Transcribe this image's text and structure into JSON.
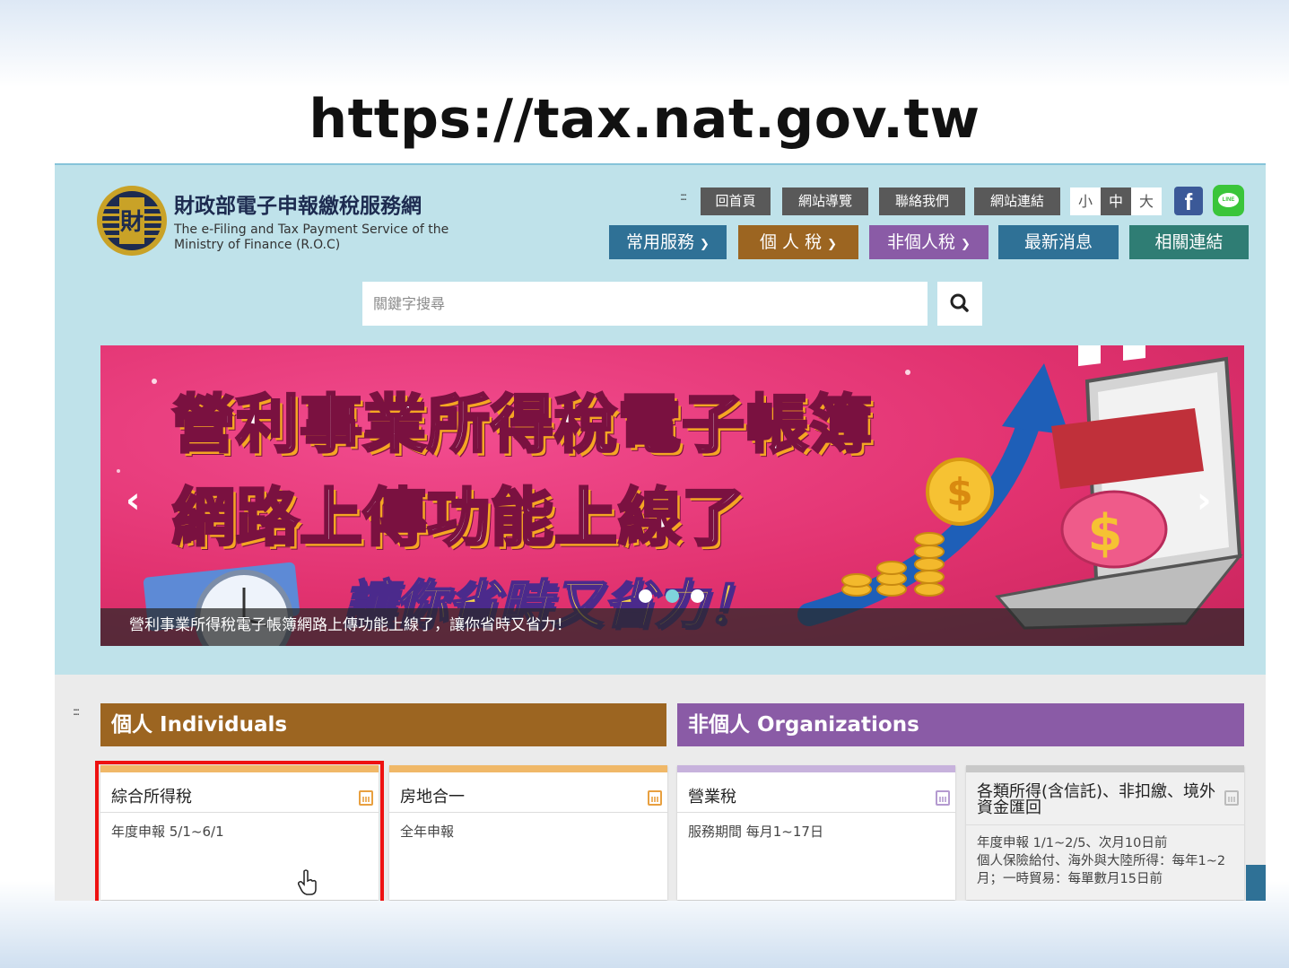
{
  "slide": {
    "title": "https://tax.nat.gov.tw"
  },
  "header": {
    "site_name": "財政部電子申報繳稅服務網",
    "site_sub": "The e-Filing and Tax Payment Service of the Ministry of Finance (R.O.C)",
    "grip": ":::",
    "top_links": [
      "回首頁",
      "網站導覽",
      "聯絡我們",
      "網站連結"
    ],
    "font_sizes": [
      "小",
      "中",
      "大"
    ],
    "social": {
      "facebook": "f",
      "line": "LINE"
    }
  },
  "nav": [
    {
      "label": "常用服務",
      "color": "#2f7196",
      "has_dropdown": true
    },
    {
      "label": "個 人 稅",
      "color": "#9c6521",
      "has_dropdown": true
    },
    {
      "label": "非個人稅",
      "color": "#8a5ba6",
      "has_dropdown": true
    },
    {
      "label": "最新消息",
      "color": "#2f7196",
      "has_dropdown": false
    },
    {
      "label": "相關連結",
      "color": "#2f7d74",
      "has_dropdown": false
    }
  ],
  "search": {
    "placeholder": "關鍵字搜尋",
    "icon": "search-icon"
  },
  "banner": {
    "line1": "營利事業所得稅電子帳簿",
    "line2": "網路上傳功能上線了",
    "line3": "讓你省時又省力！",
    "caption": "營利事業所得稅電子帳簿網路上傳功能上線了，讓你省時又省力！",
    "prev_icon": "‹",
    "next_icon": "›",
    "slide_count": 3,
    "active_slide": 2
  },
  "sections": {
    "grip": ":::",
    "individuals": {
      "label": "個人 Individuals",
      "color": "#9c6521"
    },
    "organizations": {
      "label": "非個人 Organizations",
      "color": "#8a5ba6"
    }
  },
  "cards": [
    {
      "title": "綜合所得稅",
      "sub": "年度申報 5/1~6/1",
      "accent": "#f0b868",
      "icon_color": "#e8a040"
    },
    {
      "title": "房地合一",
      "sub": "全年申報",
      "accent": "#f0b868",
      "icon_color": "#e8a040"
    },
    {
      "title": "營業稅",
      "sub": "服務期間 每月1~17日",
      "accent": "#c7b2dc",
      "icon_color": "#b49ad0"
    },
    {
      "title": "各類所得(含信託)、非扣繳、境外資金匯回",
      "sub": "年度申報 1/1~2/5、次月10日前\n個人保險給付、海外與大陸所得：每年1~2月；一時貿易：每單數月15日前",
      "accent": "#c8c8c8",
      "icon_color": "#bbbbbb"
    }
  ]
}
